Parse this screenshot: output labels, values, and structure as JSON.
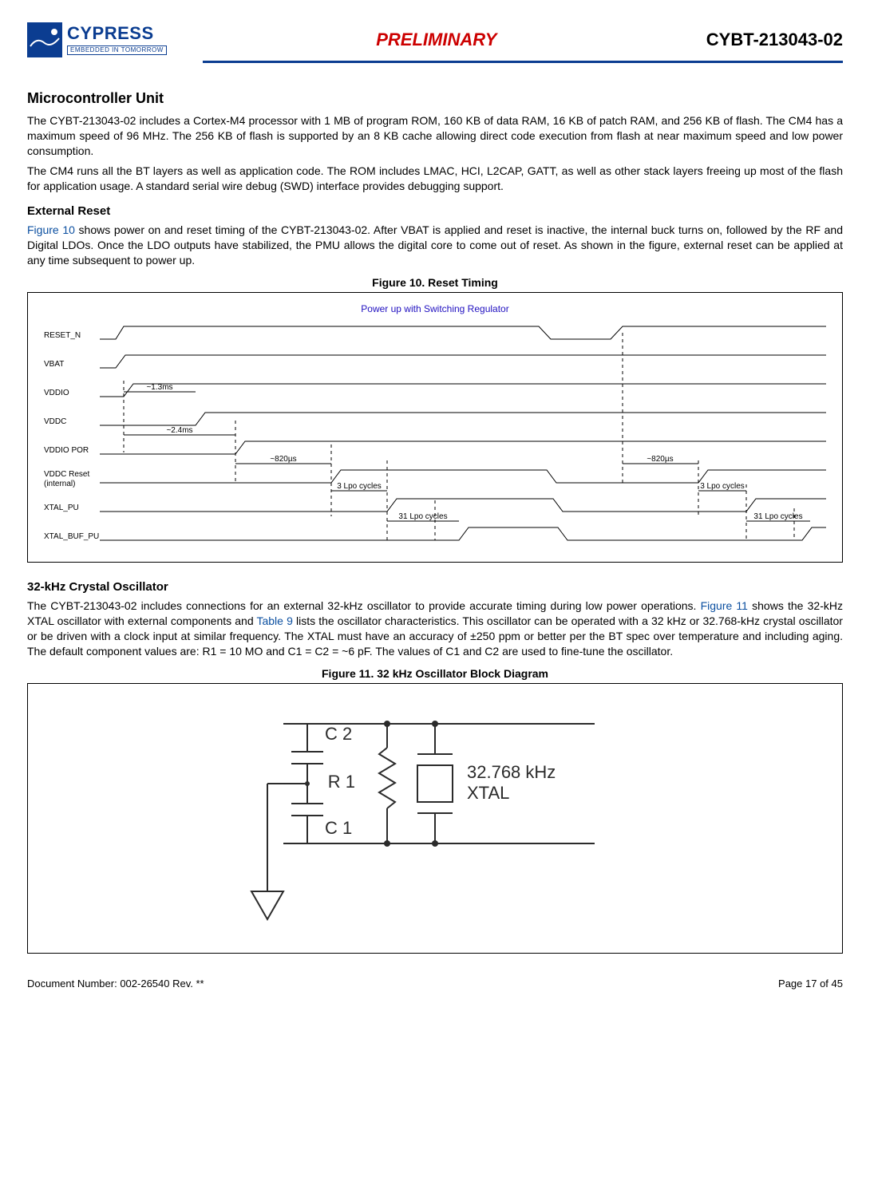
{
  "header": {
    "logo_name": "CYPRESS",
    "logo_tag": "EMBEDDED IN TOMORROW",
    "mid": "PRELIMINARY",
    "right": "CYBT-213043-02"
  },
  "sections": {
    "mcu_title": "Microcontroller Unit",
    "mcu_p1": "The CYBT-213043-02 includes a Cortex-M4 processor with 1 MB of program ROM, 160 KB of data RAM, 16 KB of patch RAM, and 256 KB of flash. The CM4 has a maximum speed of 96 MHz. The 256 KB of flash is supported by an 8 KB cache allowing direct code execution from flash at near maximum speed and low power consumption.",
    "mcu_p2": "The CM4 runs all the BT layers as well as application code. The ROM includes LMAC, HCI, L2CAP, GATT, as well as other stack layers freeing up most of the flash for application usage. A standard serial wire debug (SWD) interface provides debugging support.",
    "ext_reset_title": "External Reset",
    "ext_reset_link": "Figure 10",
    "ext_reset_p": " shows power on and reset timing of the CYBT-213043-02. After VBAT is applied and reset is inactive, the internal buck turns on, followed by the RF and Digital LDOs. Once the LDO outputs have stabilized, the PMU allows the digital core to come out of reset. As shown in the figure, external reset can be applied at any time subsequent to power up.",
    "fig10_title": "Figure 10.  Reset Timing",
    "osc_title": "32-kHz Crystal Oscillator",
    "osc_p_a": "The CYBT-213043-02 includes connections for an external 32-kHz oscillator to provide accurate timing during low power operations. ",
    "osc_link1": "Figure 11",
    "osc_p_b": " shows the 32-kHz XTAL oscillator with external components and ",
    "osc_link2": "Table 9",
    "osc_p_c": " lists the oscillator characteristics. This oscillator can be operated with a 32 kHz or 32.768-kHz crystal oscillator or be driven with a clock input at similar frequency. The XTAL must have an accuracy of ±250 ppm or better per the BT spec over temperature and including aging. The default component values are: R1 = 10 MO and C1 = C2 = ~6 pF. The values of C1 and C2 are used to fine-tune the oscillator.",
    "fig11_title": "Figure 11.  32 kHz Oscillator Block Diagram"
  },
  "timing": {
    "top_note": "Power up with Switching Regulator",
    "signals": [
      "RESET_N",
      "VBAT",
      "VDDIO",
      "VDDC",
      "VDDIO POR",
      "VDDC Reset\n(internal)",
      "XTAL_PU",
      "XTAL_BUF_PU"
    ],
    "t1": "~1.3ms",
    "t2": "~2.4ms",
    "t3": "~820µs",
    "t3b": "~820µs",
    "t4": "3 Lpo cycles",
    "t4b": "3 Lpo cycles",
    "t5": "31 Lpo cycles",
    "t5b": "31 Lpo cycles"
  },
  "osc": {
    "c2": "C 2",
    "c1": "C 1",
    "r1": "R 1",
    "xtal": "32.768 kHz\nXTAL"
  },
  "footer": {
    "left": "Document Number: 002-26540 Rev. **",
    "right": "Page 17 of 45"
  }
}
